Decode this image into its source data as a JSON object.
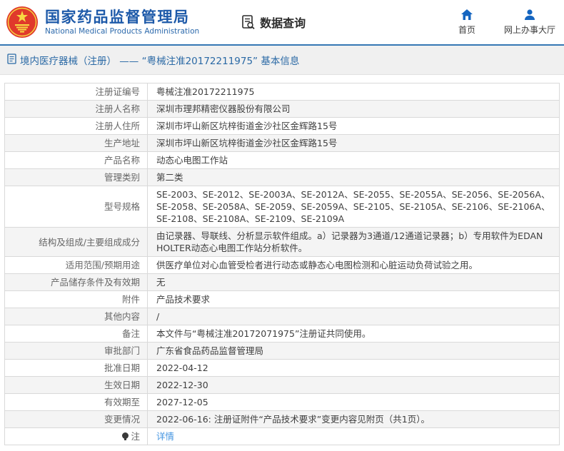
{
  "header": {
    "logo_title": "国家药品监督管理局",
    "logo_subtitle": "National Medical Products Administration",
    "nav_query_label": "数据查询",
    "home_label": "首页",
    "service_hall_label": "网上办事大厅"
  },
  "title_bar": {
    "text": "境内医疗器械（注册） —— “粤械注准20172211975” 基本信息"
  },
  "table": {
    "rows": [
      {
        "label": "注册证编号",
        "value": "粤械注准20172211975"
      },
      {
        "label": "注册人名称",
        "value": "深圳市理邦精密仪器股份有限公司"
      },
      {
        "label": "注册人住所",
        "value": "深圳市坪山新区坑梓街道金沙社区金辉路15号"
      },
      {
        "label": "生产地址",
        "value": "深圳市坪山新区坑梓街道金沙社区金辉路15号"
      },
      {
        "label": "产品名称",
        "value": "动态心电图工作站"
      },
      {
        "label": "管理类别",
        "value": "第二类"
      },
      {
        "label": "型号规格",
        "value": "SE-2003、SE-2012、SE-2003A、SE-2012A、SE-2055、SE-2055A、SE-2056、SE-2056A、SE-2058、SE-2058A、SE-2059、SE-2059A、SE-2105、SE-2105A、SE-2106、SE-2106A、SE-2108、SE-2108A、SE-2109、SE-2109A"
      },
      {
        "label": "结构及组成/主要组成成分",
        "value": "由记录器、导联线、分析显示软件组成。a）记录器为3通道/12通道记录器；b）专用软件为EDAN HOLTER动态心电图工作站分析软件。"
      },
      {
        "label": "适用范围/预期用途",
        "value": "供医疗单位对心血管受检者进行动态或静态心电图检测和心脏运动负荷试验之用。"
      },
      {
        "label": "产品储存条件及有效期",
        "value": "无"
      },
      {
        "label": "附件",
        "value": "产品技术要求"
      },
      {
        "label": "其他内容",
        "value": "/"
      },
      {
        "label": "备注",
        "value": "本文件与“粤械注准20172071975”注册证共同使用。"
      },
      {
        "label": "审批部门",
        "value": "广东省食品药品监督管理局"
      },
      {
        "label": "批准日期",
        "value": "2022-04-12"
      },
      {
        "label": "生效日期",
        "value": "2022-12-30"
      },
      {
        "label": "有效期至",
        "value": "2027-12-05"
      },
      {
        "label": "变更情况",
        "value": "2022-06-16: 注册证附件“产品技术要求”变更内容见附页（共1页）。"
      },
      {
        "label": "注",
        "value": "详情"
      }
    ]
  },
  "colors": {
    "brand_blue": "#1e5aa9",
    "accent_border_blue": "#3577b4",
    "title_text_blue": "#2a69a5",
    "link_blue": "#4495e1",
    "emblem_red": "#e0392b",
    "emblem_gold": "#f7d842",
    "icon_blue": "#1565c0",
    "row_alt_grey": "#f4f4f4",
    "bar_grey": "#f0f0f0"
  }
}
